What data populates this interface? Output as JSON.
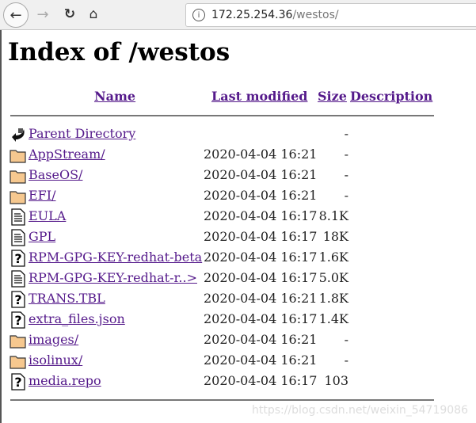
{
  "browser": {
    "url_host": "172.25.254.36",
    "url_path": "/westos/"
  },
  "title": "Index of /westos",
  "headers": {
    "name": "Name",
    "modified": "Last modified",
    "size": "Size",
    "description": "Description"
  },
  "rows": [
    {
      "icon": "back",
      "name": "Parent Directory",
      "date": "",
      "size": "-"
    },
    {
      "icon": "folder",
      "name": "AppStream/",
      "date": "2020-04-04 16:21",
      "size": "-"
    },
    {
      "icon": "folder",
      "name": "BaseOS/",
      "date": "2020-04-04 16:21",
      "size": "-"
    },
    {
      "icon": "folder",
      "name": "EFI/",
      "date": "2020-04-04 16:21",
      "size": "-"
    },
    {
      "icon": "text",
      "name": "EULA",
      "date": "2020-04-04 16:17",
      "size": "8.1K"
    },
    {
      "icon": "text",
      "name": "GPL",
      "date": "2020-04-04 16:17",
      "size": "18K"
    },
    {
      "icon": "unknown",
      "name": "RPM-GPG-KEY-redhat-beta",
      "date": "2020-04-04 16:17",
      "size": "1.6K"
    },
    {
      "icon": "text",
      "name": "RPM-GPG-KEY-redhat-r..>",
      "date": "2020-04-04 16:17",
      "size": "5.0K"
    },
    {
      "icon": "unknown",
      "name": "TRANS.TBL",
      "date": "2020-04-04 16:21",
      "size": "1.8K"
    },
    {
      "icon": "unknown",
      "name": "extra_files.json",
      "date": "2020-04-04 16:17",
      "size": "1.4K"
    },
    {
      "icon": "folder",
      "name": "images/",
      "date": "2020-04-04 16:21",
      "size": "-"
    },
    {
      "icon": "folder",
      "name": "isolinux/",
      "date": "2020-04-04 16:21",
      "size": "-"
    },
    {
      "icon": "unknown",
      "name": "media.repo",
      "date": "2020-04-04 16:17",
      "size": "103"
    }
  ],
  "watermark": "https://blog.csdn.net/weixin_54719086"
}
